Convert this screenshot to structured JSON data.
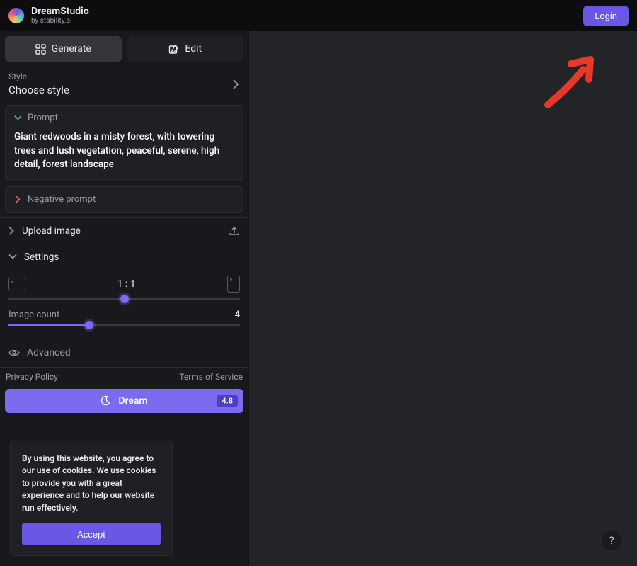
{
  "header": {
    "title": "DreamStudio",
    "subtitle": "by stability.ai",
    "login": "Login"
  },
  "tabs": {
    "generate": "Generate",
    "edit": "Edit"
  },
  "style": {
    "label": "Style",
    "value": "Choose style"
  },
  "prompt": {
    "label": "Prompt",
    "text": "Giant redwoods in a misty forest, with towering trees and lush vegetation, peaceful, serene, high detail, forest landscape"
  },
  "negative": {
    "label": "Negative prompt"
  },
  "upload": {
    "label": "Upload image"
  },
  "settings": {
    "label": "Settings",
    "ratio": "1 : 1",
    "image_count_label": "Image count",
    "image_count_value": "4",
    "advanced": "Advanced"
  },
  "footer": {
    "privacy": "Privacy Policy",
    "terms": "Terms of Service"
  },
  "dream": {
    "label": "Dream",
    "cost": "4.8"
  },
  "cookie": {
    "text": "By using this website, you agree to our use of cookies. We use cookies to provide you with a great experience and to help our website run effectively.",
    "accept": "Accept"
  },
  "help": "?"
}
